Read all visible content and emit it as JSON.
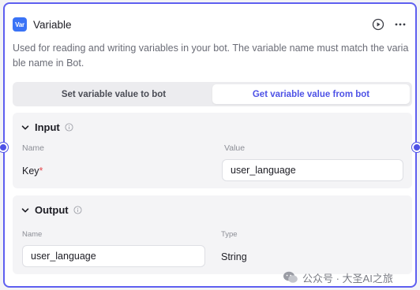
{
  "node": {
    "badge": "Var",
    "title": "Variable",
    "description": "Used for reading and writing variables in your bot. The variable name must match the variable name in Bot."
  },
  "tabs": [
    {
      "label": "Set variable value to bot",
      "active": false
    },
    {
      "label": "Get variable value from bot",
      "active": true
    }
  ],
  "input": {
    "title": "Input",
    "name_header": "Name",
    "value_header": "Value",
    "key_label": "Key",
    "required_mark": "*",
    "key_value": "user_language"
  },
  "output": {
    "title": "Output",
    "name_header": "Name",
    "type_header": "Type",
    "name_value": "user_language",
    "type_value": "String"
  },
  "watermark": {
    "text": "公众号 · 大圣AI之旅"
  },
  "colors": {
    "accent": "#4e52e6",
    "badge_bg": "#3a73f6",
    "required": "#e5484d"
  },
  "icons": [
    "play-circle-icon",
    "more-icon",
    "chevron-down-icon",
    "info-icon",
    "wechat-icon"
  ]
}
